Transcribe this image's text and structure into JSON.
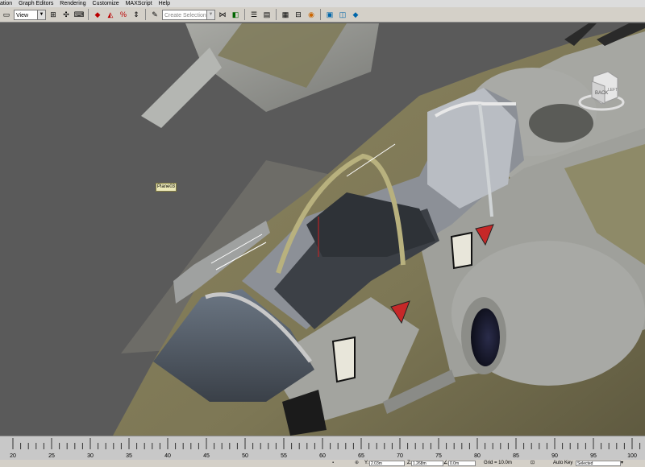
{
  "menu": [
    "ation",
    "Graph Editors",
    "Rendering",
    "Customize",
    "MAXScript",
    "Help"
  ],
  "toolbar": {
    "view_dropdown": "View",
    "selection_set_placeholder": "Create Selection Set"
  },
  "viewport": {
    "object_label": "Plane03",
    "navcube_faces": {
      "front": "BACK",
      "side": "LEFT"
    }
  },
  "timeline": {
    "labels": [
      "20",
      "25",
      "30",
      "35",
      "40",
      "45",
      "50",
      "55",
      "60",
      "65",
      "70",
      "75",
      "80",
      "85",
      "90",
      "95",
      "100"
    ]
  },
  "status": {
    "y_label": "Y:",
    "y_value": "2.03m",
    "z_label": "Z:",
    "z_value": "1.268m",
    "angle_value": "0.0m",
    "grid": "Grid = 10.0m",
    "autokey": "Auto Key",
    "selected": "Selected"
  }
}
